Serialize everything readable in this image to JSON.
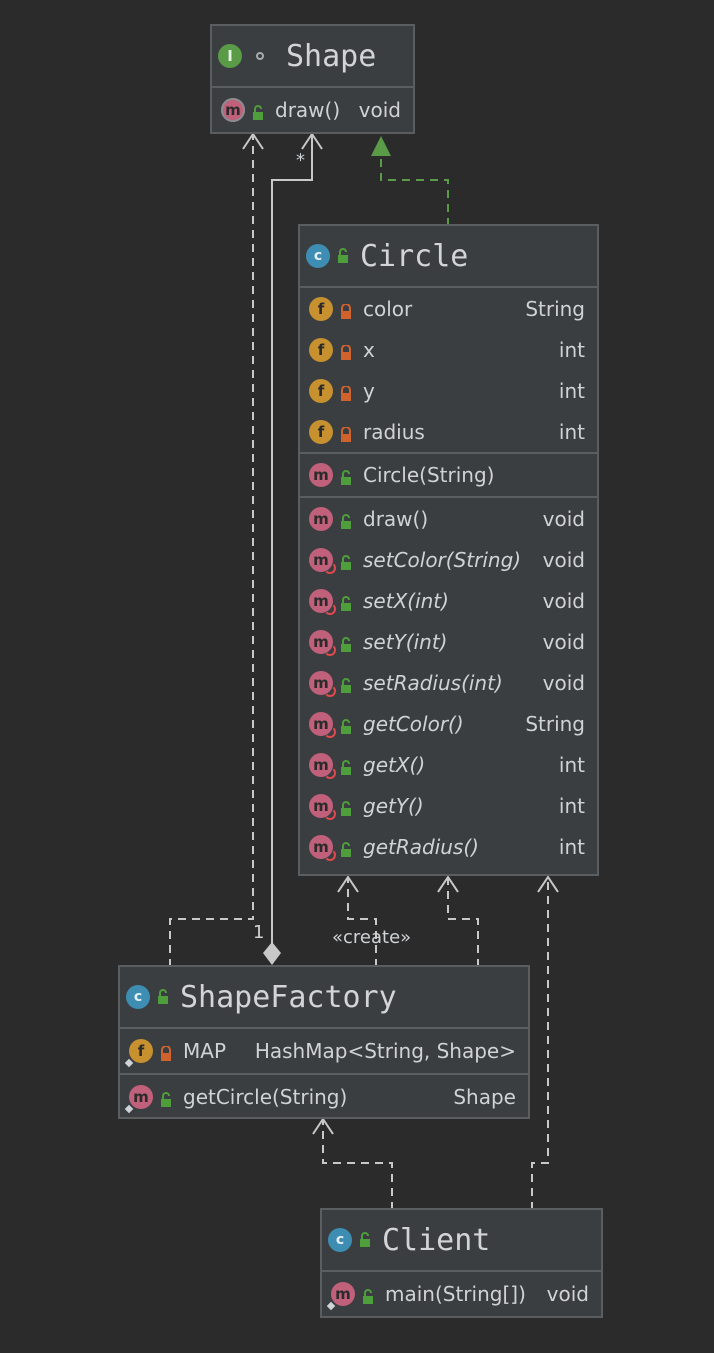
{
  "shape": {
    "badge": "I",
    "name": "Shape",
    "methods": [
      {
        "name": "draw()",
        "type": "void"
      }
    ]
  },
  "circle": {
    "badge": "c",
    "name": "Circle",
    "fields": [
      {
        "name": "color",
        "type": "String"
      },
      {
        "name": "x",
        "type": "int"
      },
      {
        "name": "y",
        "type": "int"
      },
      {
        "name": "radius",
        "type": "int"
      }
    ],
    "constructors": [
      {
        "name": "Circle(String)",
        "type": ""
      }
    ],
    "methods": [
      {
        "name": "draw()",
        "type": "void"
      },
      {
        "name": "setColor(String)",
        "type": "void"
      },
      {
        "name": "setX(int)",
        "type": "void"
      },
      {
        "name": "setY(int)",
        "type": "void"
      },
      {
        "name": "setRadius(int)",
        "type": "void"
      },
      {
        "name": "getColor()",
        "type": "String"
      },
      {
        "name": "getX()",
        "type": "int"
      },
      {
        "name": "getY()",
        "type": "int"
      },
      {
        "name": "getRadius()",
        "type": "int"
      }
    ]
  },
  "shapefactory": {
    "badge": "c",
    "name": "ShapeFactory",
    "fields": [
      {
        "name": "MAP",
        "type": "HashMap<String, Shape>"
      }
    ],
    "methods": [
      {
        "name": "getCircle(String)",
        "type": "Shape"
      }
    ]
  },
  "client": {
    "badge": "c",
    "name": "Client",
    "methods": [
      {
        "name": "main(String[])",
        "type": "void"
      }
    ]
  },
  "labels": {
    "multiplicity_many": "*",
    "multiplicity_one": "1",
    "create": "«create»"
  },
  "badge_letters": {
    "method": "m",
    "field": "f"
  },
  "colors": {
    "background": "#2b2b2b",
    "box": "#3b3e40",
    "border": "#5b5e61",
    "interface_badge": "#5a9b47",
    "class_badge": "#3d8eb2",
    "method_badge": "#c0607a",
    "field_badge": "#c8912f",
    "public_lock": "#4f9e3c",
    "private_lock": "#d0622d",
    "realization_line": "#5a9b47",
    "dependency_line": "#c8c8c8"
  }
}
